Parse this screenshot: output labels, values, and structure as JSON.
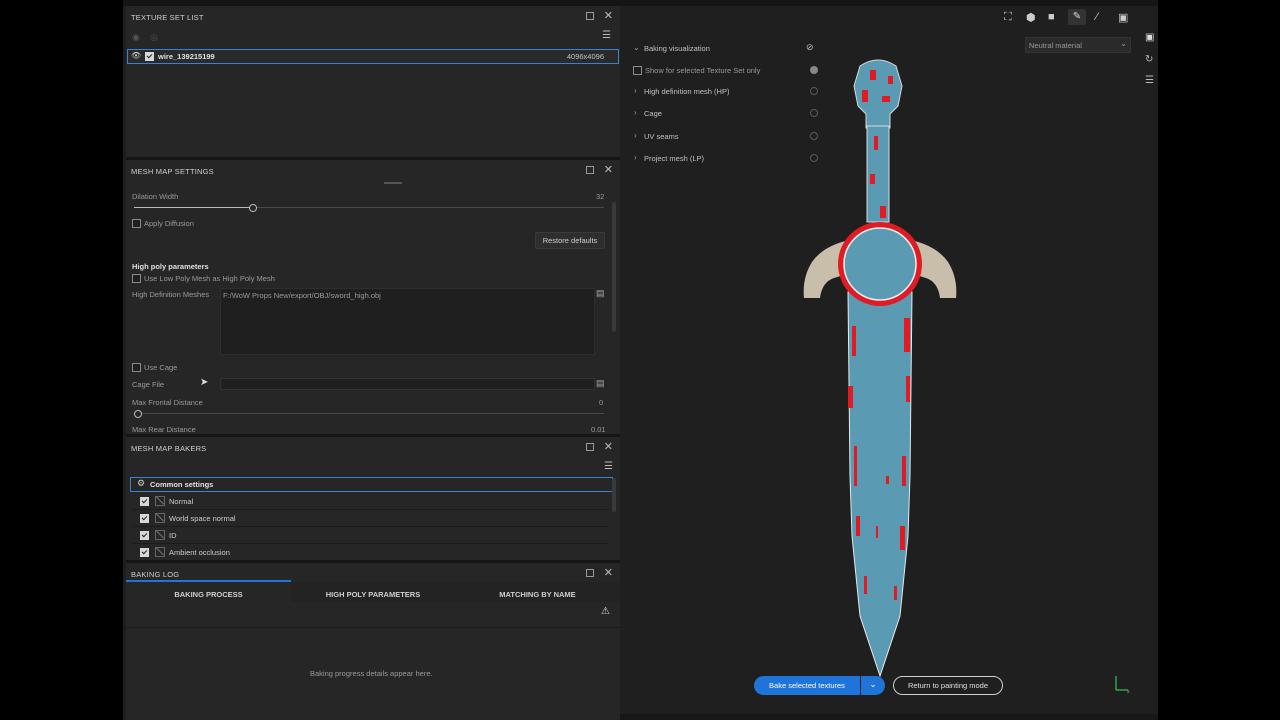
{
  "texture_set_list": {
    "title": "TEXTURE SET LIST",
    "item_name": "wire_139215199",
    "item_resolution": "4096x4096"
  },
  "mesh_map_settings": {
    "title": "MESH MAP SETTINGS",
    "dilation_label": "Dilation Width",
    "dilation_value": "32",
    "dilation_fraction": 0.25,
    "apply_diffusion_label": "Apply Diffusion",
    "restore_defaults_label": "Restore defaults",
    "high_poly_section": "High poly parameters",
    "use_low_poly_label": "Use Low Poly Mesh as High Poly Mesh",
    "hd_meshes_label": "High Definition Meshes",
    "hd_meshes_value": "F:/WoW Props New/export/OBJ/sword_high.obj",
    "use_cage_label": "Use Cage",
    "cage_file_label": "Cage File",
    "max_frontal_label": "Max Frontal Distance",
    "max_frontal_value": "0",
    "max_rear_label": "Max Rear Distance",
    "max_rear_value": "0.01"
  },
  "mesh_map_bakers": {
    "title": "MESH MAP BAKERS",
    "common_settings": "Common settings",
    "bakers": [
      {
        "label": "Normal",
        "checked": true
      },
      {
        "label": "World space normal",
        "checked": true
      },
      {
        "label": "ID",
        "checked": true
      },
      {
        "label": "Ambient occlusion",
        "checked": true
      }
    ]
  },
  "baking_log": {
    "title": "BAKING LOG",
    "tabs": [
      "BAKING PROCESS",
      "HIGH POLY PARAMETERS",
      "MATCHING BY NAME"
    ],
    "active_tab": 0,
    "empty_message": "Baking progress details appear here."
  },
  "viewport": {
    "baking_visualization": "Baking visualization",
    "show_selected_only": "Show for selected Texture Set only",
    "items": [
      "High definition mesh (HP)",
      "Cage",
      "UV seams",
      "Project mesh (LP)"
    ],
    "material_select": "Neutral material",
    "bake_button": "Bake selected textures",
    "return_button": "Return to painting mode"
  },
  "colors": {
    "accent": "#1e74d8",
    "mesh_blue": "#5a9bb3",
    "mesh_red": "#e01b24",
    "guard_beige": "#c8beaa",
    "panel": "#262626",
    "viewport": "#1f1f1f"
  },
  "icons": [
    "eye-icon",
    "checkbox-icon",
    "pin-icon",
    "close-icon",
    "menu-icon",
    "file-icon",
    "gear-icon",
    "hide-icon",
    "camera-icon",
    "brush-icon",
    "chevron-down-icon",
    "warning-icon",
    "axis-gizmo-icon"
  ]
}
